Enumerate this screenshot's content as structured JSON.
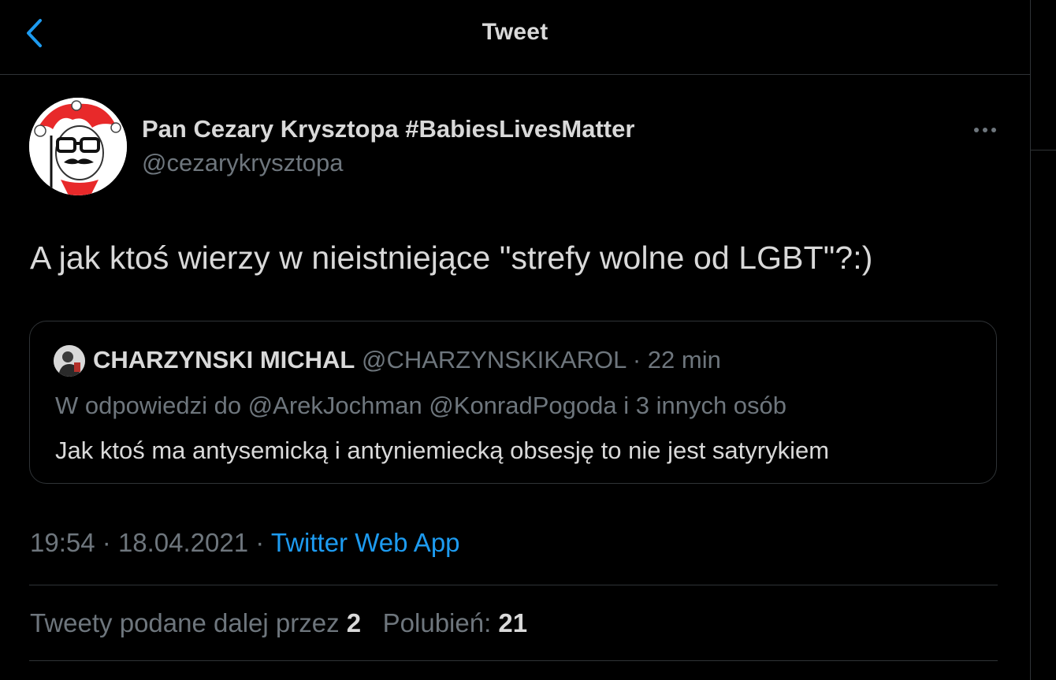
{
  "header": {
    "title": "Tweet",
    "back_icon": "chevron-left-icon"
  },
  "colors": {
    "background": "#000000",
    "text": "#d9d9d9",
    "muted": "#6e767d",
    "accent": "#1d9bf0",
    "border": "#2f3336"
  },
  "tweet": {
    "author": {
      "name": "Pan Cezary Krysztopa #BabiesLivesMatter",
      "handle": "@cezarykrysztopa"
    },
    "more_icon": "more-horizontal-icon",
    "text": "A jak ktoś wierzy w nieistniejące \"strefy wolne od LGBT\"?:)",
    "quote": {
      "name": "CHARZYNSKI MICHAL",
      "handle": "@CHARZYNSKIKAROL",
      "separator": "·",
      "time": "22 min",
      "reply_to": "W odpowiedzi do @ArekJochman @KonradPogoda i 3 innych osób",
      "body": "Jak ktoś ma antysemicką i antyniemiecką obsesję to nie jest satyrykiem"
    },
    "time": "19:54",
    "sep1": "·",
    "date": "18.04.2021",
    "sep2": "·",
    "source": "Twitter Web App",
    "stats": {
      "retweets_label": "Tweety podane dalej przez",
      "retweets_count": "2",
      "likes_label": "Polubień:",
      "likes_count": "21"
    }
  }
}
